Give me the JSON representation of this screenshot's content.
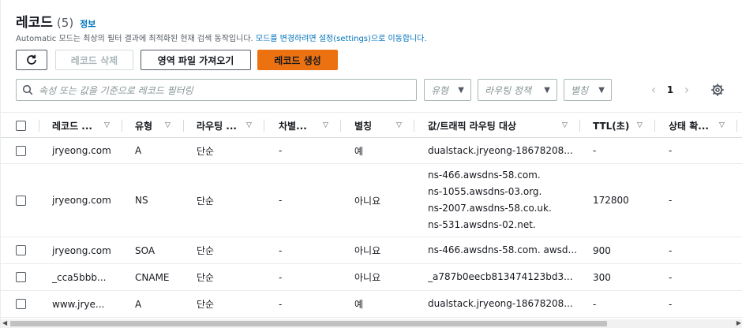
{
  "header": {
    "title": "레코드",
    "count": "(5)",
    "info": "정보"
  },
  "description": {
    "text": "Automatic 모드는 최상의 필터 결과에 최적화된 현재 검색 동작입니다. ",
    "link": "모드를 변경하려면 설정(settings)으로 이동합니다."
  },
  "toolbar": {
    "delete_label": "레코드 삭제",
    "import_label": "영역 파일 가져오기",
    "create_label": "레코드 생성"
  },
  "filter": {
    "search_placeholder": "속성 또는 값을 기준으로 레코드 필터링",
    "type": "유형",
    "routing_policy": "라우팅 정책",
    "alias": "별칭"
  },
  "pagination": {
    "page": "1"
  },
  "table": {
    "columns": [
      "레코드 ...",
      "유형",
      "라우팅 ...",
      "차별...",
      "별칭",
      "값/트래픽 라우팅 대상",
      "TTL(초)",
      "상태 확..."
    ],
    "rows": [
      {
        "name": "jryeong.com",
        "type": "A",
        "policy": "단순",
        "diff": "-",
        "alias": "예",
        "value": [
          "dualstack.jryeong-18678208..."
        ],
        "ttl": "-",
        "health": "-"
      },
      {
        "name": "jryeong.com",
        "type": "NS",
        "policy": "단순",
        "diff": "-",
        "alias": "아니요",
        "value": [
          "ns-466.awsdns-58.com.",
          "ns-1055.awsdns-03.org.",
          "ns-2007.awsdns-58.co.uk.",
          "ns-531.awsdns-02.net."
        ],
        "ttl": "172800",
        "health": "-"
      },
      {
        "name": "jryeong.com",
        "type": "SOA",
        "policy": "단순",
        "diff": "-",
        "alias": "아니요",
        "value": [
          "ns-466.awsdns-58.com. awsd..."
        ],
        "ttl": "900",
        "health": "-"
      },
      {
        "name": "_cca5bbb...",
        "type": "CNAME",
        "policy": "단순",
        "diff": "-",
        "alias": "아니요",
        "value": [
          "_a787b0eecb813474123bd3..."
        ],
        "ttl": "300",
        "health": "-"
      },
      {
        "name": "www.jrye...",
        "type": "A",
        "policy": "단순",
        "diff": "-",
        "alias": "예",
        "value": [
          "dualstack.jryeong-18678208..."
        ],
        "ttl": "-",
        "health": "-"
      }
    ]
  },
  "colors": {
    "accent": "#ec7211",
    "link": "#0073bb",
    "text": "#16191f",
    "muted": "#545b64"
  }
}
